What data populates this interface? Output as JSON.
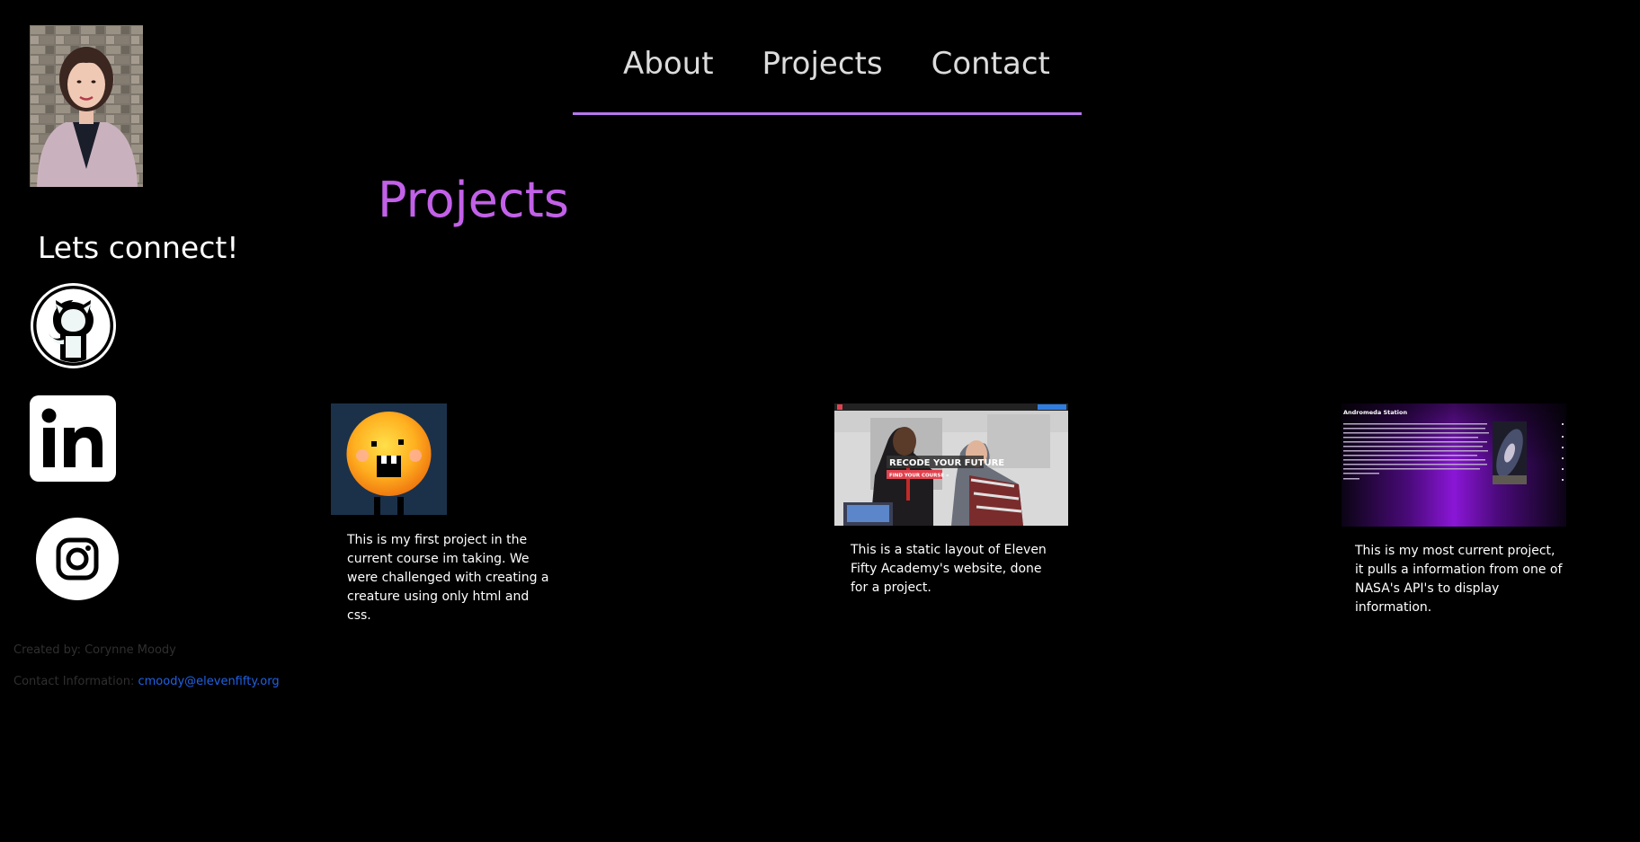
{
  "sidebar": {
    "connect_heading": "Lets connect!",
    "social": [
      {
        "name": "GitHub",
        "icon": "github-icon"
      },
      {
        "name": "LinkedIn",
        "icon": "linkedin-icon"
      },
      {
        "name": "Instagram",
        "icon": "instagram-icon"
      }
    ]
  },
  "nav": {
    "links": [
      "About",
      "Projects",
      "Contact"
    ],
    "underline_color": "#b877ee"
  },
  "main": {
    "title": "Projects",
    "title_color": "#c261e8",
    "projects": [
      {
        "thumbnail": "creature-thumbnail",
        "description": "This is my first project in the current course im taking. We were challenged with creating a creature using only html and css."
      },
      {
        "thumbnail": "eleven-fifty-thumbnail",
        "banner_text": "RECODE YOUR FUTURE",
        "button_text": "FIND YOUR COURSE »",
        "description": "This is a static layout of Eleven Fifty Academy's website, done for a project."
      },
      {
        "thumbnail": "andromeda-station-thumbnail",
        "site_title": "Andromeda Station",
        "description": "This is my most current project, it pulls a information from one of NASA's API's to display information."
      }
    ]
  },
  "footer": {
    "credit": "Created by: Corynne Moody",
    "contact_label": "Contact Information:",
    "email": "cmoody@elevenfifty.org",
    "email_color": "#1f62e6"
  }
}
